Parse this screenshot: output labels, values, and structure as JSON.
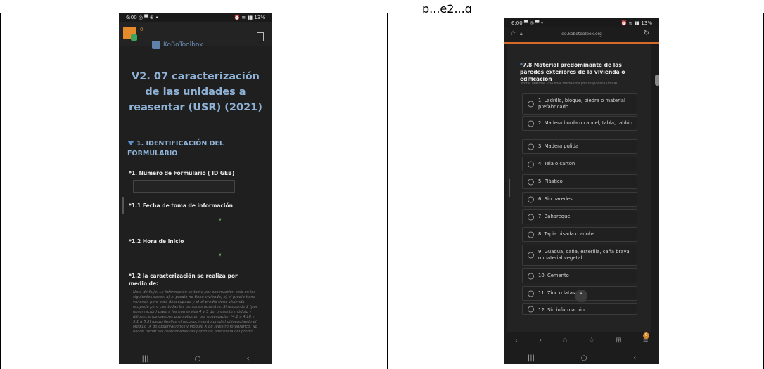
{
  "top_fragment": {
    "text": "p...e2...g"
  },
  "phone1": {
    "status_time": "6:00",
    "status_icons_left": "◎ ▀ ⊕ •",
    "status_icons_right": "⏰ ≋ ▮▮ 13%",
    "pending_count": "0",
    "logo_text": "KoBoToolbox",
    "form_title": "V2. 07 caracterización de las unidades a reasentar (USR) (2021)",
    "section_title": "1. IDENTIFICACIÓN DEL FORMULARIO",
    "questions": [
      {
        "label": "1. Número de Formulario ( ID GEB)"
      },
      {
        "label": "1.1 Fecha de toma de información"
      },
      {
        "label": "1.2 Hora de inicio"
      },
      {
        "label": "1.2 la caracterización se realiza por medio de:"
      }
    ],
    "note": "Nota de flujo: La información se toma por observación solo en los siguientes casos: a) el predio no tiene vivienda; b) el predio tiene vivienda pero está desocupada y c) el predio tiene vivienda ocupada pero con todas las personas ausentes. Si responde 2 (por observación) pase a los numerales 4 y 5 del presente módulo y diligencie los campos que apliquen por observación (4.1 a 4.18 y 5.1 a 5.3) luego finalice el reconocimiento predial diligenciando el Módulo IX de observaciones y Módulo X de registro fotográfico. No olvide tomar las coordenadas del punto de referencia del predio.",
    "nav": [
      "|||",
      "○",
      "‹"
    ]
  },
  "phone2": {
    "status_time": "6:00",
    "status_icons_left": "▀ ◎ ▀ •",
    "status_icons_right": "⏰ ≋ ▮▮ 13%",
    "url": "ee.kobotoolbox.org",
    "question": "7.8 Material predominante de las paredes exteriores de la vivienda o edificación",
    "hint": "Nota: Marque una sola respuesta (de respuesta única)",
    "options": [
      "1. Ladrillo, bloque, piedra o material prefabricado",
      "2. Madera burda o cancel, tabla, tablón",
      "3. Madera pulida",
      "4. Tela o cartón",
      "5. Plástico",
      "6. Sin paredes",
      "7. Bahareque",
      "8. Tapia pisada o adobe",
      "9. Guadua, caña, esterilla, caña brava o material vegetal",
      "10. Cemento",
      "11. Zinc o latas",
      "12. Sin información"
    ],
    "browser_nav": [
      "‹",
      "›",
      "⌂",
      "☆",
      "⊞",
      "≡"
    ],
    "tab_badge": "9",
    "nav": [
      "|||",
      "○",
      "‹"
    ]
  },
  "colors": {
    "accent_blue": "#8fb2d6",
    "orange": "#d76c2a",
    "background": "#1f1f1f"
  }
}
